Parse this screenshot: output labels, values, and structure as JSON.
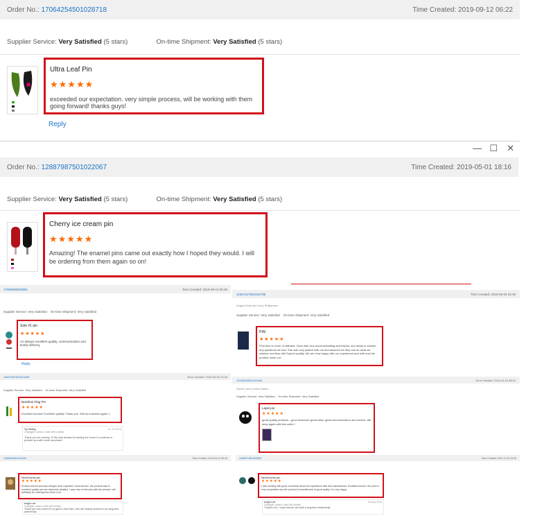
{
  "p1": {
    "order_label": "Order No.:",
    "order_no": "17064254501028718",
    "time_label": "Time Created:",
    "time": "2019-09-12 06:22",
    "supplier_label": "Supplier Service:",
    "supplier_val": "Very Satisfied",
    "supplier_stars": "(5 stars)",
    "ship_label": "On-time Shipment:",
    "ship_val": "Very Satisfied",
    "ship_stars": "(5 stars)",
    "product": "Ultra Leaf Pin",
    "stars": "★★★★★",
    "review": "exceeded our expectation. very simple process, will be working with them going forward! thanks guys!",
    "reply": "Reply"
  },
  "p2": {
    "order_label": "Order No.:",
    "order_no": "12887987501022067",
    "time_label": "Time Created:",
    "time": "2019-05-01 18:16",
    "supplier_label": "Supplier Service:",
    "supplier_val": "Very Satisfied",
    "supplier_stars": "(5 stars)",
    "ship_label": "On-time Shipment:",
    "ship_val": "Very Satisfied",
    "ship_stars": "(5 stars)",
    "product": "Cherry ice cream pin",
    "stars": "★★★★★",
    "review": "Amazing! The enamel pins came out exactly how I hoped they would. I will be ordering from them again so on!"
  },
  "window": {
    "minimize": "—",
    "maximize": "☐",
    "close": "✕"
  },
  "t1": {
    "order_no": "17062580920851",
    "time": "Time Created: 2019-09-12 06:38",
    "supplier": "Supplier Service: Very Satisfied",
    "ship": "On-time Shipment: Very Satisfied",
    "product": "Sole #1 pin",
    "stars": "★★★★★",
    "review": "As always excellent quality, communication and timely delivery.",
    "reply": "Reply"
  },
  "t2": {
    "order_no": "11947317501022786",
    "time": "Time Created: 2019-06-06 04:49",
    "customer": "Angela Eden (lei bros) Philippines",
    "supplier": "Supplier Service: Very Satisfied",
    "ship": "On-time Shipment: Very Satisfied",
    "product": "PIN!",
    "stars": "★★★★★",
    "review": "First time to order on Alibaba. Carol was very accommodating and helpful, and ready to answer any questions we had. She was very patient with me and assured me they can do what we wanted, and they did! Superb quality. We are very happy with our experience and with how the product came out."
  },
  "t3": {
    "order_no": "11641947501023405",
    "time": "Time Created: 2019-06-26 10:34",
    "supplier": "Supplier Service: Very Satisfied",
    "ship": "On-time Shipment: Very Satisfied",
    "product": "Brazilian Flag Pin",
    "stars": "★★★★★",
    "review": "Excellent service! Excellent quality! Thank you. Will do business again :)",
    "seller": "Vy Huang",
    "company": "Changde Joineo Craft Gift Limited",
    "seller_date": "11 Jul 2019",
    "seller_reply": "Thank you for coming :D We look forward to having the honor to continue to provide you with more surprises!"
  },
  "t4": {
    "order_no": "11135604501023464",
    "time": "Time Created: 2019-04-15 08:42",
    "customer": "Darrell Jones United States",
    "supplier": "Supplier Service: Very Satisfied",
    "ship": "On-time Shipment: Very Satisfied",
    "product": "Lapel pin",
    "stars": "★★★★★",
    "review": "great quality products - good business! great seller great communication and service. will shop again with this seller !"
  },
  "t5": {
    "order_no": "11864094501020406",
    "time": "Time Created: 2019-04-12 09:26",
    "product": "NeoEnamel pin",
    "stars": "★★★★★",
    "review": "Product arrived and was cheaper than expected. Good service. the product was of excellent quality and are extremely detailed. I was very on the pins with the product. will definitely be ordering from them a lot.",
    "seller": "sergio Lee",
    "company": "Changde Joineo Craft Gift Limited",
    "seller_reply": "Thank you very much! It's so glad to hear that :) We are looking forward to our long-term partnership."
  },
  "t6": {
    "order_no": "11828174501020567",
    "time": "Time Created: 2019-11-03 19:29",
    "product": "NeoEnamel pin",
    "stars": "★★★★★",
    "review": "I was working with good comments about the experience with this manufacturer. Excellent service, the price is very competitive and the product is beautiful and of good quality. I'm very happy.",
    "seller": "sergio Lee",
    "company": "Changde Joineo Craft Gift Limited",
    "seller_date": "28 May 2019",
    "seller_reply": "Thanks a lot, I hope that we can build a long term relationship."
  },
  "colors": {
    "accent": "#1a73c8",
    "highlight": "#d0101a",
    "star": "#ff6a00",
    "header_bg": "#f0f0f0"
  }
}
